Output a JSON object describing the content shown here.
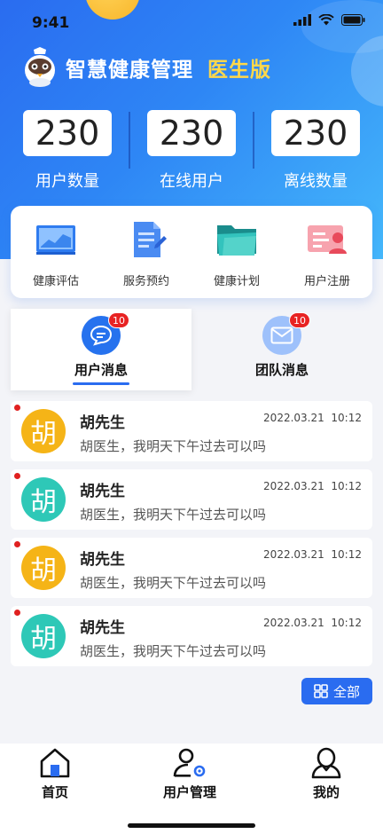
{
  "status": {
    "time": "9:41"
  },
  "app": {
    "title": "智慧健康管理",
    "subtitle": "医生版"
  },
  "stats": [
    {
      "value": "230",
      "label": "用户数量"
    },
    {
      "value": "230",
      "label": "在线用户"
    },
    {
      "value": "230",
      "label": "离线数量"
    }
  ],
  "quick_menu": [
    {
      "label": "健康评估",
      "icon": "chart-board-icon"
    },
    {
      "label": "服务预约",
      "icon": "document-edit-icon"
    },
    {
      "label": "健康计划",
      "icon": "folder-icon"
    },
    {
      "label": "用户注册",
      "icon": "user-card-icon"
    }
  ],
  "tabs": [
    {
      "label": "用户消息",
      "badge": "10",
      "icon": "chat-bubble-icon",
      "active": true
    },
    {
      "label": "团队消息",
      "badge": "10",
      "icon": "mail-icon",
      "active": false
    }
  ],
  "messages": [
    {
      "avatar": "胡",
      "avatar_color": "#f5b417",
      "name": "胡先生",
      "text": "胡医生，我明天下午过去可以吗",
      "date": "2022.03.21",
      "time": "10:12",
      "unread": true
    },
    {
      "avatar": "胡",
      "avatar_color": "#2ec8b7",
      "name": "胡先生",
      "text": "胡医生，我明天下午过去可以吗",
      "date": "2022.03.21",
      "time": "10:12",
      "unread": true
    },
    {
      "avatar": "胡",
      "avatar_color": "#f5b417",
      "name": "胡先生",
      "text": "胡医生，我明天下午过去可以吗",
      "date": "2022.03.21",
      "time": "10:12",
      "unread": true
    },
    {
      "avatar": "胡",
      "avatar_color": "#2ec8b7",
      "name": "胡先生",
      "text": "胡医生，我明天下午过去可以吗",
      "date": "2022.03.21",
      "time": "10:12",
      "unread": true
    }
  ],
  "all_button": {
    "label": "全部",
    "icon": "grid-icon"
  },
  "nav": [
    {
      "label": "首页",
      "icon": "home-icon"
    },
    {
      "label": "用户管理",
      "icon": "user-settings-icon"
    },
    {
      "label": "我的",
      "icon": "person-icon"
    }
  ],
  "colors": {
    "primary": "#2a6cf0",
    "accent": "#ffd84a",
    "badge": "#e82323"
  }
}
